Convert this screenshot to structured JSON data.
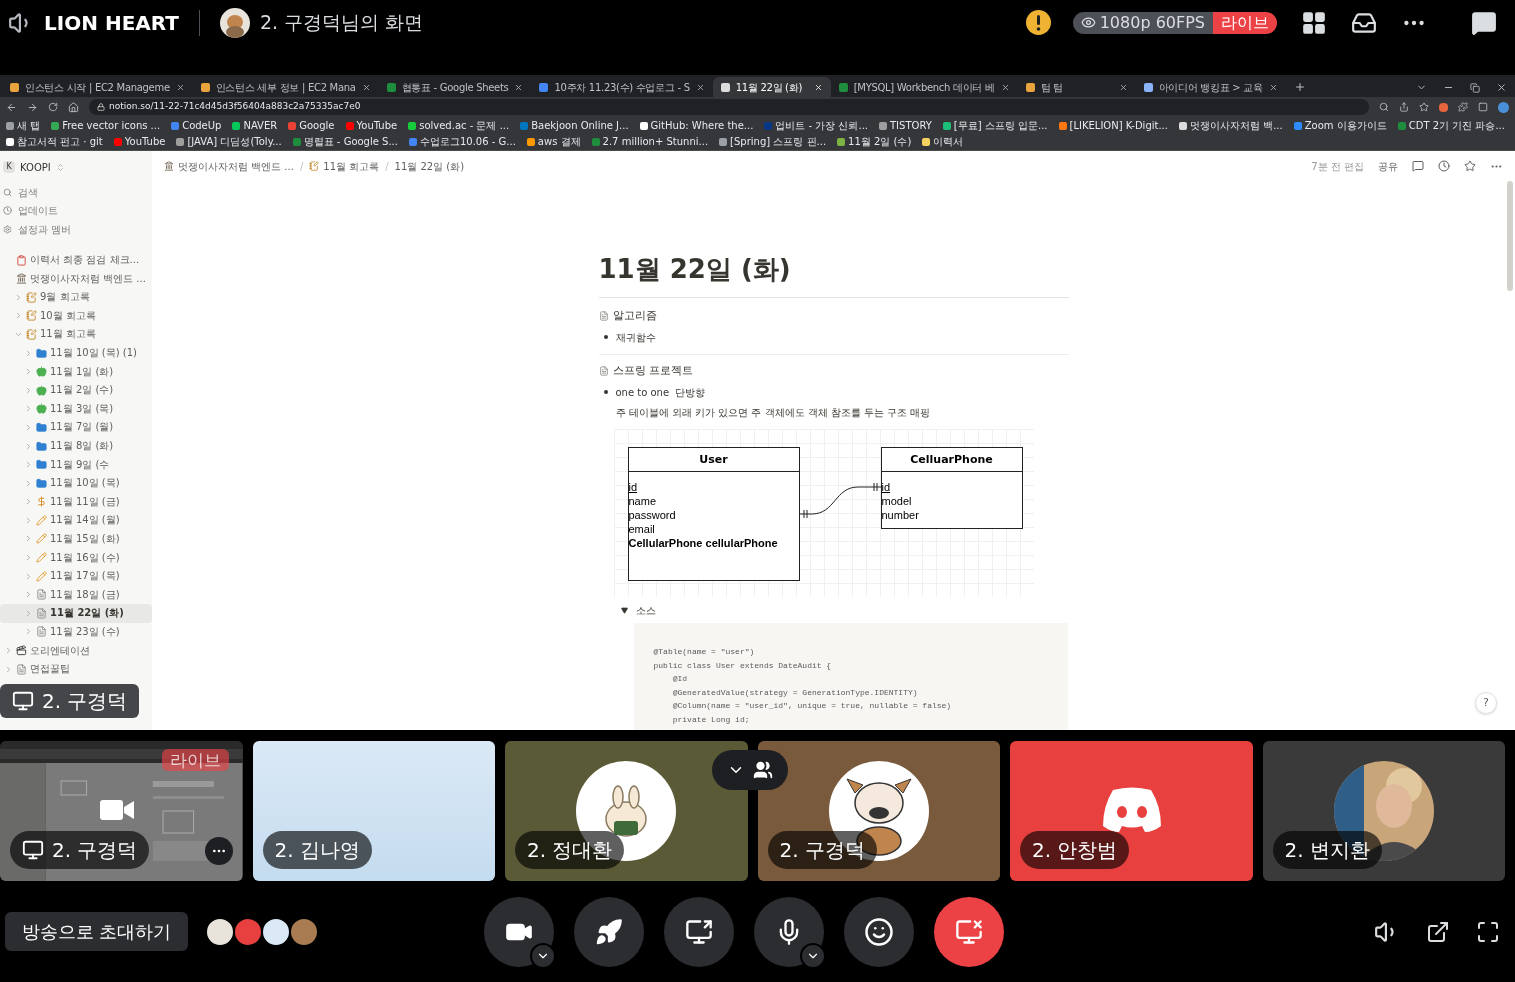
{
  "topbar": {
    "server": "LION HEART",
    "stream_title": "2. 구경덕님의 화면",
    "quality": "1080p 60FPS",
    "live_badge": "라이브"
  },
  "browser": {
    "tabs": [
      {
        "title": "인스턴스 시작 | EC2 Manageme",
        "color": "#e8a33d",
        "selected": false
      },
      {
        "title": "인스턴스 세부 정보 | EC2 Mana",
        "color": "#e8a33d",
        "selected": false
      },
      {
        "title": "협통표 - Google Sheets",
        "color": "#1e8e3e",
        "selected": false
      },
      {
        "title": "10주차 11.23(수) 수업로그 - S",
        "color": "#4285f4",
        "selected": false
      },
      {
        "title": "11월 22일 (화)",
        "color": "#dddddd",
        "selected": true
      },
      {
        "title": "[MYSQL] Workbench 데이터 베",
        "color": "#1e8e3e",
        "selected": false
      },
      {
        "title": "텀 텀",
        "color": "#e8a33d",
        "selected": false
      },
      {
        "title": "아이디어 뱅킹표 > 교육",
        "color": "#8ab4f8",
        "selected": false
      }
    ],
    "address": "notion.so/11-22-71c4d45d3f56404a883c2a75335ac7e0",
    "bookmarks": [
      {
        "label": "새 탭",
        "color": "#9aa0a6"
      },
      {
        "label": "Free vector icons ...",
        "color": "#34a853"
      },
      {
        "label": "CodeUp",
        "color": "#4285f4"
      },
      {
        "label": "NAVER",
        "color": "#03c75a"
      },
      {
        "label": "Google",
        "color": "#ea4335"
      },
      {
        "label": "YouTube",
        "color": "#ff0000"
      },
      {
        "label": "solved.ac - 문제 ...",
        "color": "#17ce3a"
      },
      {
        "label": "Baekjoon Online J...",
        "color": "#0076c0"
      },
      {
        "label": "GitHub: Where the...",
        "color": "#ffffff"
      },
      {
        "label": "업비트 - 가장 신뢰...",
        "color": "#093687"
      },
      {
        "label": "TISTORY",
        "color": "#9e9e9e"
      },
      {
        "label": "[무료] 스프링 입문...",
        "color": "#1dc078"
      },
      {
        "label": "[LIKELION] K-Digit...",
        "color": "#ff7710"
      },
      {
        "label": "멋쟁이사자처럼 백...",
        "color": "#dddddd"
      },
      {
        "label": "Zoom 이용가이드",
        "color": "#2d8cff"
      },
      {
        "label": "CDT 2기 기진 파승...",
        "color": "#1e8e3e"
      },
      {
        "label": "참고서적 펀고 · git",
        "color": "#ffffff"
      },
      {
        "label": "YouTube",
        "color": "#ff0000"
      },
      {
        "label": "[JAVA] 디딤성(Toly...",
        "color": "#9e9e9e"
      },
      {
        "label": "명렬표 - Google S...",
        "color": "#1e8e3e"
      },
      {
        "label": "수업로그10.06 - G...",
        "color": "#4285f4"
      },
      {
        "label": "aws 결제",
        "color": "#ff9900"
      },
      {
        "label": "2.7 million+ Stunni...",
        "color": "#1e8e3e"
      },
      {
        "label": "[Spring] 스프링 핀...",
        "color": "#9aa0a6"
      },
      {
        "label": "11월 2일 (수)",
        "color": "#7cb342"
      },
      {
        "label": "이력서",
        "color": "#f4d35e"
      }
    ]
  },
  "notion": {
    "workspace": "KOOPI",
    "workspace_initial": "K",
    "menu": [
      {
        "label": "검색",
        "kind": "search"
      },
      {
        "label": "업데이트",
        "kind": "updates"
      },
      {
        "label": "설정과 멤버",
        "kind": "settings"
      }
    ],
    "pages": [
      {
        "label": "이력서 최종 점검 체크...",
        "kind": "clipboard",
        "selected": false
      },
      {
        "label": "멋쟁이사자처럼 백엔드 ...",
        "kind": "bank",
        "selected": false,
        "children": [
          {
            "label": "9월 회고록",
            "kind": "memo",
            "expanded": false,
            "selected": false
          },
          {
            "label": "10월 회고록",
            "kind": "memo",
            "expanded": false,
            "selected": false
          },
          {
            "label": "11월 회고록",
            "kind": "memo",
            "expanded": true,
            "selected": false,
            "children": [
              {
                "label": "11월 10일 (목) (1)",
                "kind": "folder",
                "expanded": false,
                "selected": false
              },
              {
                "label": "11월 1일 (화)",
                "kind": "apple",
                "expanded": false,
                "selected": false
              },
              {
                "label": "11월 2일 (수)",
                "kind": "apple",
                "expanded": false,
                "selected": false
              },
              {
                "label": "11월 3일 (목)",
                "kind": "apple",
                "expanded": false,
                "selected": false
              },
              {
                "label": "11월 7일 (월)",
                "kind": "folder",
                "expanded": false,
                "selected": false
              },
              {
                "label": "11월 8일 (화)",
                "kind": "folder",
                "expanded": false,
                "selected": false
              },
              {
                "label": "11월 9일 (수",
                "kind": "folder",
                "expanded": false,
                "selected": false
              },
              {
                "label": "11월 10일 (목)",
                "kind": "folder",
                "expanded": false,
                "selected": false
              },
              {
                "label": "11월 11일 (금)",
                "kind": "money",
                "expanded": false,
                "selected": false
              },
              {
                "label": "11월 14일 (월)",
                "kind": "pencil",
                "expanded": false,
                "selected": false
              },
              {
                "label": "11월 15일 (화)",
                "kind": "pencil",
                "expanded": false,
                "selected": false
              },
              {
                "label": "11월 16일 (수)",
                "kind": "pencil",
                "expanded": false,
                "selected": false
              },
              {
                "label": "11월 17일 (목)",
                "kind": "pencil",
                "expanded": false,
                "selected": false
              },
              {
                "label": "11월 18일 (금)",
                "kind": "page",
                "expanded": false,
                "selected": false
              },
              {
                "label": "11월 22일 (화)",
                "kind": "page",
                "expanded": false,
                "selected": true
              },
              {
                "label": "11월 23일 (수)",
                "kind": "page",
                "expanded": false,
                "selected": false
              }
            ]
          }
        ]
      },
      {
        "label": "오리엔테이션",
        "kind": "clapper",
        "expanded": false,
        "selected": false
      },
      {
        "label": "면접꿀팁",
        "kind": "page",
        "expanded": false,
        "selected": false
      }
    ],
    "breadcrumbs": [
      {
        "label": "멋쟁이사자처럼 백엔드 ...",
        "kind": "bank"
      },
      {
        "separator": "/",
        "label": "11월 회고록",
        "kind": "memo"
      },
      {
        "separator": "/",
        "label": "11월 22일 (화)"
      }
    ],
    "edited": "7분 전 편집",
    "share": "공유",
    "title": "11월 22일 (화)",
    "section1": {
      "heading": "알고리즘",
      "bullets": [
        "재귀함수"
      ]
    },
    "section2": {
      "heading": "스프링 프로젝트",
      "bullets": [
        "one to one  단방향"
      ],
      "paragraph": "주 테이블에 외래 키가 있으면 주 객체에도 객체 참조를 두는 구조 매핑"
    },
    "diagram": {
      "entities": [
        {
          "name": "User",
          "fields": [
            {
              "text": "id",
              "kind": "key"
            },
            {
              "text": "name",
              "kind": "plain"
            },
            {
              "text": "password",
              "kind": "plain"
            },
            {
              "text": "email",
              "kind": "plain"
            },
            {
              "text": "CellularPhone cellularPhone",
              "kind": "reference"
            }
          ]
        },
        {
          "name": "CelluarPhone",
          "fields": [
            {
              "text": "id",
              "kind": "key"
            },
            {
              "text": "model",
              "kind": "plain"
            },
            {
              "text": "number",
              "kind": "plain"
            }
          ]
        }
      ]
    },
    "toggle": {
      "label": "소스",
      "expanded": true
    },
    "code": [
      "@Table(name = \"user\")",
      "public class User extends DateAudit {",
      "    @Id",
      "    @GeneratedValue(strategy = GenerationType.IDENTITY)",
      "    @Column(name = \"user_id\", unique = true, nullable = false)",
      "    private Long id;"
    ],
    "help": "?"
  },
  "stream_overlay": "2. 구경덕",
  "participants": [
    {
      "name": "2. 구경덕",
      "kind": "screen",
      "live_badge": "라이브"
    },
    {
      "name": "2. 김나영",
      "kind": "blank"
    },
    {
      "name": "2. 정대환",
      "kind": "avatar"
    },
    {
      "name": "2. 구경덕",
      "kind": "dog"
    },
    {
      "name": "2. 안창범",
      "kind": "logo"
    },
    {
      "name": "2. 변지환"
    }
  ],
  "invite_button": "방송으로 초대하기"
}
